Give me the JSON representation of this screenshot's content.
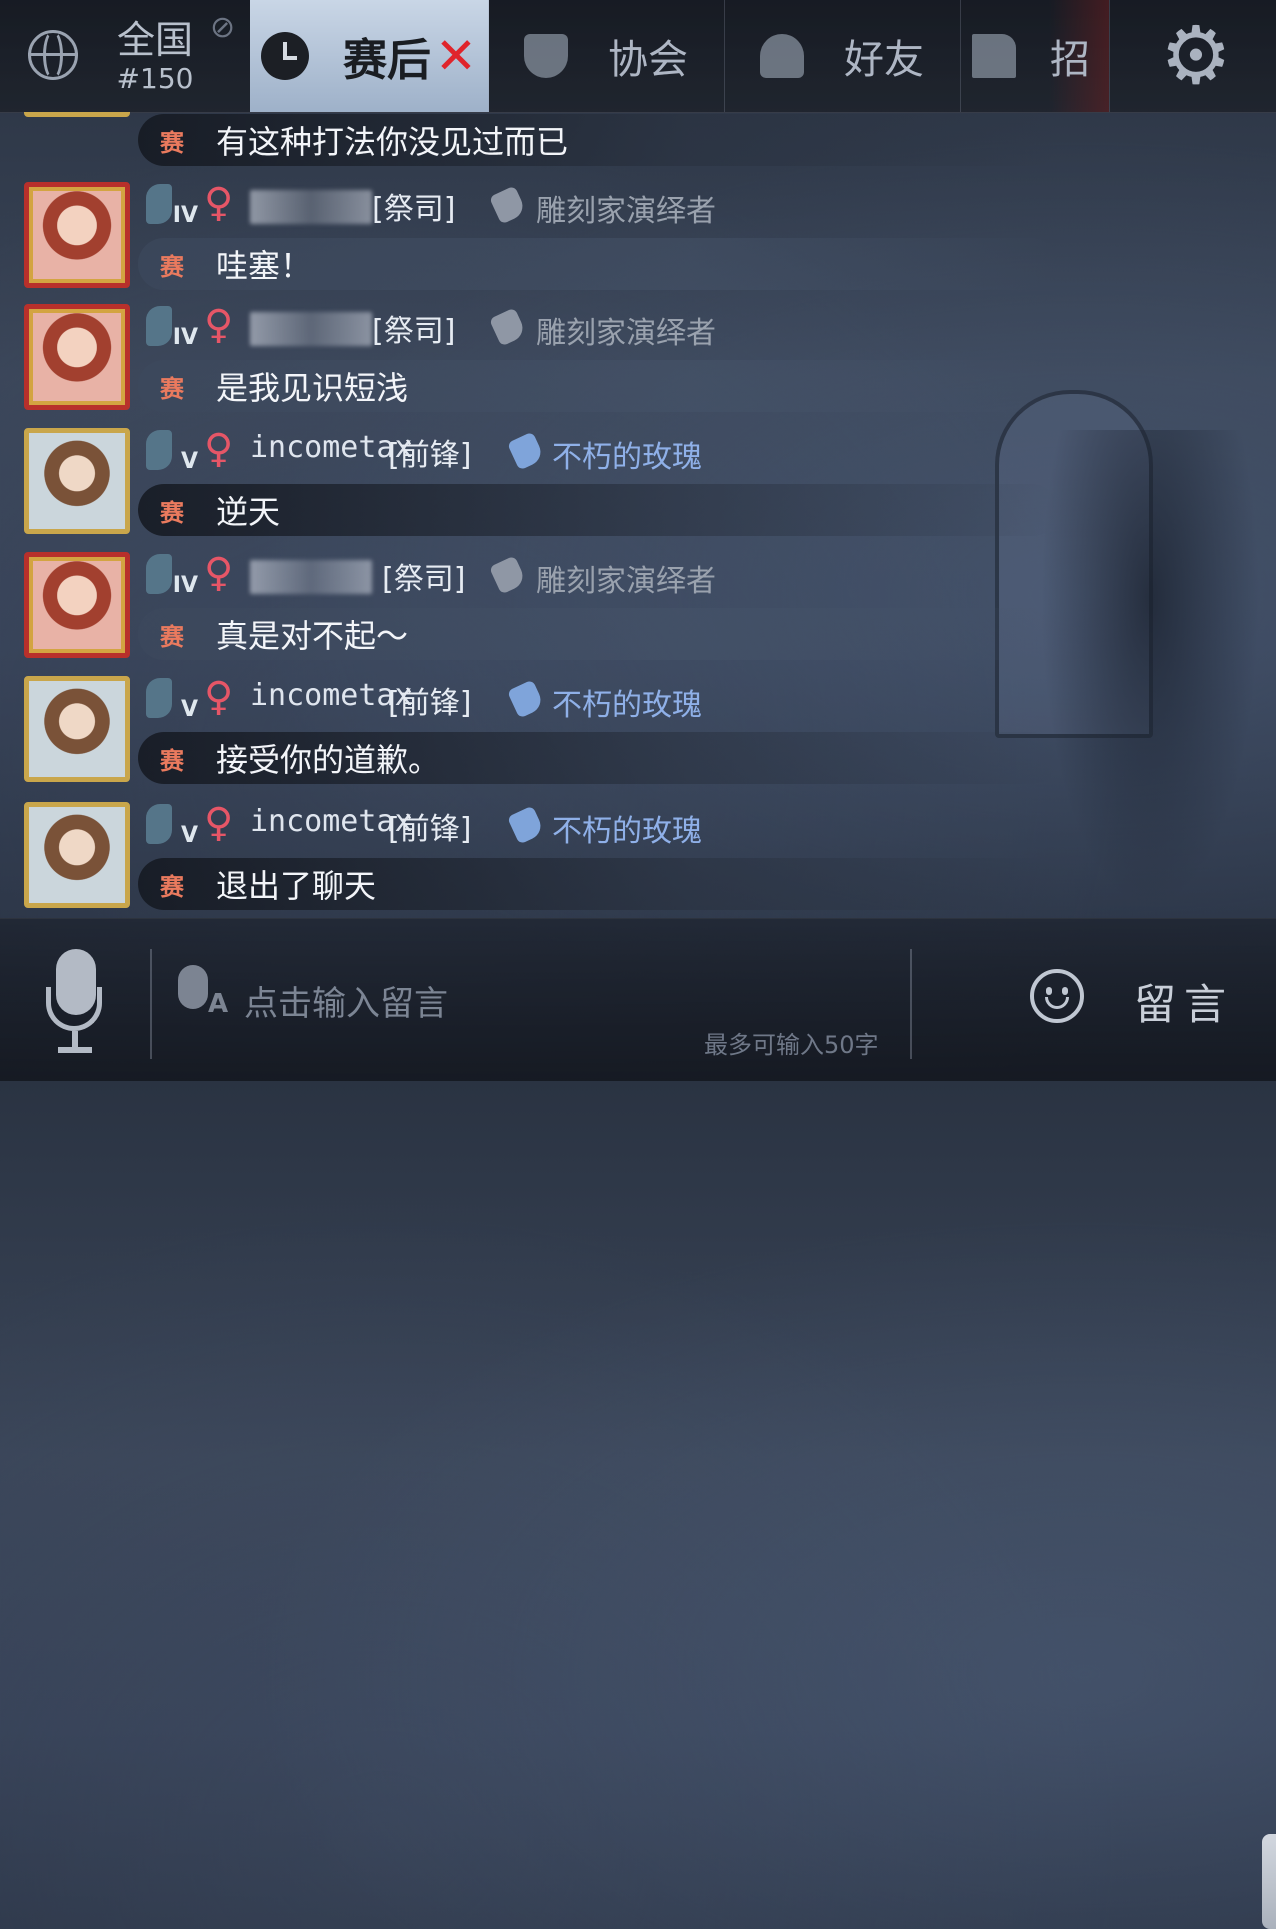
{
  "tabs": {
    "national": {
      "label": "全国",
      "rank": "#150"
    },
    "postgame": {
      "label": "赛后"
    },
    "association": {
      "label": "协会"
    },
    "friends": {
      "label": "好友"
    },
    "recruit": {
      "label": "招"
    }
  },
  "messages": [
    {
      "channel": "赛",
      "text": "有这种打法你没见过而已"
    },
    {
      "username": "",
      "role": "[祭司]",
      "title": "雕刻家演绎者",
      "tier": "IV",
      "channel": "赛",
      "text": "哇塞！"
    },
    {
      "username": "",
      "role": "[祭司]",
      "title": "雕刻家演绎者",
      "tier": "IV",
      "channel": "赛",
      "text": "是我见识短浅"
    },
    {
      "username": "incometax",
      "role": "[前锋]",
      "title": "不朽的玫瑰",
      "tier": "V",
      "channel": "赛",
      "text": "逆天"
    },
    {
      "username": "",
      "role": "[祭司]",
      "title": "雕刻家演绎者",
      "tier": "IV",
      "channel": "赛",
      "text": "真是对不起～"
    },
    {
      "username": "incometax",
      "role": "[前锋]",
      "title": "不朽的玫瑰",
      "tier": "V",
      "channel": "赛",
      "text": "接受你的道歉。"
    },
    {
      "username": "incometax",
      "role": "[前锋]",
      "title": "不朽的玫瑰",
      "tier": "V",
      "channel": "赛",
      "text": "退出了聊天"
    }
  ],
  "input": {
    "placeholder": "点击输入留言",
    "char_limit": "最多可输入50字",
    "send_label": "留言"
  },
  "icons": [
    "globe-icon",
    "mute-icon",
    "clock-icon",
    "close-icon",
    "shield-icon",
    "people-icon",
    "flag-icon",
    "gear-icon",
    "tier-icon",
    "female-icon",
    "tag-icon",
    "microphone-icon",
    "voice-to-text-icon",
    "emoji-icon"
  ],
  "colors": {
    "accent_red": "#e0242b",
    "gender_pink": "#e65667",
    "title_blue": "#8fb0e8",
    "channel_orange": "#ea7a5e",
    "active_tab": "#c9d6e6"
  }
}
